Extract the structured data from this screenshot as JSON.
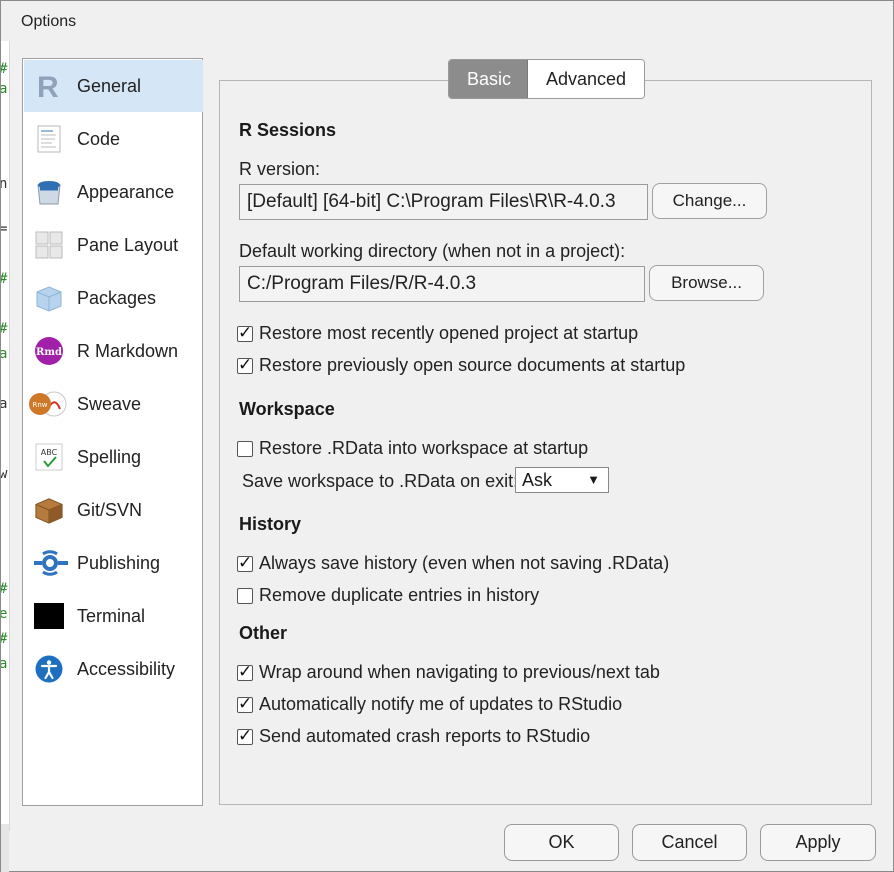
{
  "window": {
    "title": "Options"
  },
  "sidebar": {
    "items": [
      {
        "label": "General",
        "icon": "r-logo-icon",
        "selected": true
      },
      {
        "label": "Code",
        "icon": "code-document-icon"
      },
      {
        "label": "Appearance",
        "icon": "paint-bucket-icon"
      },
      {
        "label": "Pane Layout",
        "icon": "pane-grid-icon"
      },
      {
        "label": "Packages",
        "icon": "package-cube-icon"
      },
      {
        "label": "R Markdown",
        "icon": "rmd-icon"
      },
      {
        "label": "Sweave",
        "icon": "sweave-icon"
      },
      {
        "label": "Spelling",
        "icon": "spellcheck-icon"
      },
      {
        "label": "Git/SVN",
        "icon": "git-box-icon"
      },
      {
        "label": "Publishing",
        "icon": "publishing-icon"
      },
      {
        "label": "Terminal",
        "icon": "terminal-icon"
      },
      {
        "label": "Accessibility",
        "icon": "accessibility-icon"
      }
    ]
  },
  "tabs": {
    "basic": "Basic",
    "advanced": "Advanced"
  },
  "r_sessions": {
    "heading": "R Sessions",
    "r_version_label": "R version:",
    "r_version_value": "[Default] [64-bit] C:\\Program Files\\R\\R-4.0.3",
    "change_button": "Change...",
    "wd_label": "Default working directory (when not in a project):",
    "wd_value": "C:/Program Files/R/R-4.0.3",
    "browse_button": "Browse...",
    "restore_project": {
      "label": "Restore most recently opened project at startup",
      "checked": true
    },
    "restore_docs": {
      "label": "Restore previously open source documents at startup",
      "checked": true
    }
  },
  "workspace": {
    "heading": "Workspace",
    "restore_rdata": {
      "label": "Restore .RData into workspace at startup",
      "checked": false
    },
    "save_label": "Save workspace to .RData on exit:",
    "save_value": "Ask"
  },
  "history": {
    "heading": "History",
    "always_save": {
      "label": "Always save history (even when not saving .RData)",
      "checked": true
    },
    "remove_dupes": {
      "label": "Remove duplicate entries in history",
      "checked": false
    }
  },
  "other": {
    "heading": "Other",
    "wrap_tabs": {
      "label": "Wrap around when navigating to previous/next tab",
      "checked": true
    },
    "notify_updates": {
      "label": "Automatically notify me of updates to RStudio",
      "checked": true
    },
    "crash_reports": {
      "label": "Send automated crash reports to RStudio",
      "checked": true
    }
  },
  "buttons": {
    "ok": "OK",
    "cancel": "Cancel",
    "apply": "Apply"
  },
  "colors": {
    "selected_bg": "#d5e6f7",
    "active_tab": "#8c8c8c"
  }
}
